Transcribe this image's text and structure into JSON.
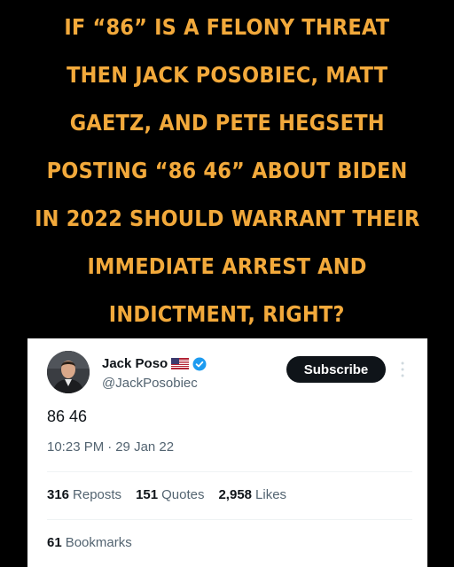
{
  "headline": {
    "lines": [
      "If “86” is a felony threat",
      "then Jack Posobiec, Matt",
      "Gaetz, and Pete Hegseth",
      "posting “86 46” about Biden",
      "in 2022 should warrant their",
      "immediate arrest and",
      "indictment, right?"
    ],
    "color": "#f2a93b"
  },
  "tweet": {
    "display_name": "Jack Poso",
    "handle": "@JackPosobiec",
    "subscribe_label": "Subscribe",
    "text": "86 46",
    "time": "10:23 PM",
    "separator": "·",
    "date": "29 Jan 22",
    "stats": {
      "reposts_count": "316",
      "reposts_label": "Reposts",
      "quotes_count": "151",
      "quotes_label": "Quotes",
      "likes_count": "2,958",
      "likes_label": "Likes",
      "bookmarks_count": "61",
      "bookmarks_label": "Bookmarks"
    },
    "icons": {
      "flag": "us-flag-icon",
      "verified": "verified-badge-icon",
      "more": "more-options-icon"
    },
    "colors": {
      "verified": "#1d9bf0",
      "secondary_text": "#536471",
      "primary_text": "#0f1419"
    }
  }
}
